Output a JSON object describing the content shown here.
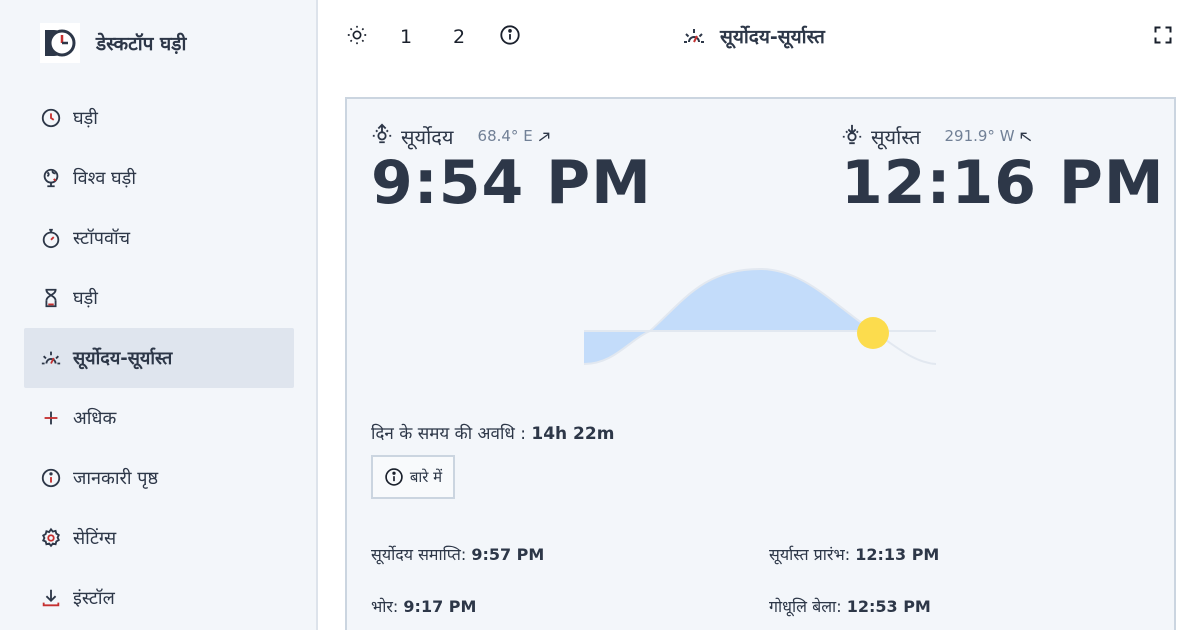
{
  "app": {
    "title": "डेस्कटॉप घड़ी",
    "logo_icon": "desktop-clock-logo"
  },
  "sidebar": {
    "items": [
      {
        "label": "घड़ी",
        "icon": "clock-icon"
      },
      {
        "label": "विश्व घड़ी",
        "icon": "globe-icon"
      },
      {
        "label": "स्टॉपवॉच",
        "icon": "stopwatch-icon"
      },
      {
        "label": "घड़ी",
        "icon": "hourglass-icon"
      },
      {
        "label": "सूर्योदय-सूर्यास्त",
        "icon": "sunrise-sunset-icon",
        "active": true
      },
      {
        "label": "अधिक",
        "icon": "plus-icon"
      },
      {
        "label": "जानकारी पृष्ठ",
        "icon": "info-icon"
      },
      {
        "label": "सेटिंग्स",
        "icon": "gear-icon"
      },
      {
        "label": "इंस्टॉल",
        "icon": "download-icon"
      }
    ]
  },
  "topbar": {
    "theme_icon": "sun-icon",
    "btn1": "1",
    "btn2": "2",
    "info_icon": "info-icon",
    "title": "सूर्योदय-सूर्यास्त",
    "fullscreen_icon": "fullscreen-icon"
  },
  "sunrise": {
    "label": "सूर्योदय",
    "azimuth": "68.4° E",
    "time": "9:54 PM"
  },
  "sunset": {
    "label": "सूर्यास्त",
    "azimuth": "291.9° W",
    "time": "12:16 PM"
  },
  "daylength": {
    "label": "दिन के समय की अवधि :",
    "value": "14h 22m"
  },
  "about": {
    "label": "बारे में"
  },
  "details": {
    "sunrise_end": {
      "label": "सूर्योदय समाप्ति:",
      "value": "9:57 PM"
    },
    "sunset_start": {
      "label": "सूर्यास्त प्रारंभ:",
      "value": "12:13 PM"
    },
    "dawn": {
      "label": "भोर:",
      "value": "9:17 PM"
    },
    "dusk": {
      "label": "गोधूलि बेला:",
      "value": "12:53 PM"
    }
  },
  "colors": {
    "accent": "#c53030",
    "daylight_fill": "#c3dcfa",
    "sun": "#fcdc4d",
    "text": "#2d3748"
  }
}
